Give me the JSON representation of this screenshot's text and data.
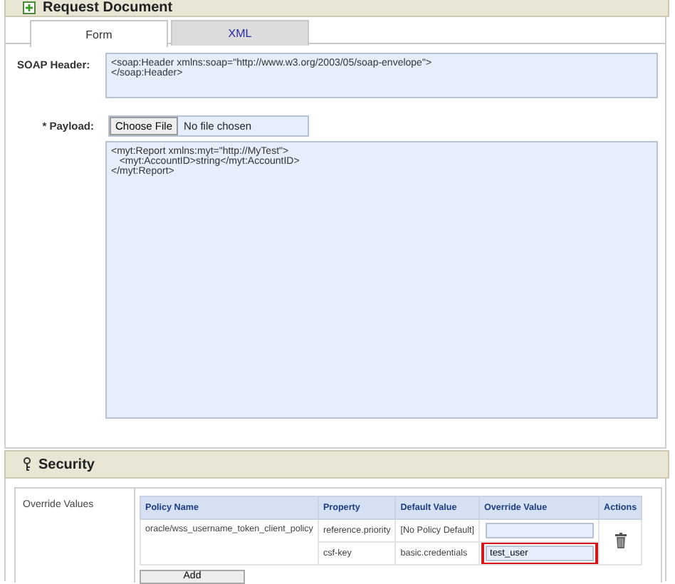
{
  "panel": {
    "title": "Request Document"
  },
  "tabs": [
    {
      "label": "Form",
      "selected": true
    },
    {
      "label": "XML",
      "selected": false
    }
  ],
  "soap_header": {
    "label": "SOAP Header:",
    "value": "<soap:Header xmlns:soap=\"http://www.w3.org/2003/05/soap-envelope\">\n</soap:Header>"
  },
  "payload": {
    "required_mark": "*",
    "label": "Payload:",
    "file_button": "Choose File",
    "file_status": "No file chosen",
    "value": "<myt:Report xmlns:myt=\"http://MyTest\">\n   <myt:AccountID>string</myt:AccountID>\n</myt:Report>"
  },
  "security": {
    "title": "Security",
    "override_label": "Override Values",
    "table": {
      "columns": [
        "Policy Name",
        "Property",
        "Default Value",
        "Override Value",
        "Actions"
      ],
      "policies": [
        {
          "name": "oracle/wss_username_token_client_policy",
          "properties": [
            {
              "property": "reference.priority",
              "default": "[No Policy Default]",
              "highlighted": false
            },
            {
              "property": "csf-key",
              "default": "basic.credentials",
              "override": "test_user",
              "highlighted": true
            }
          ]
        }
      ]
    },
    "add_button": "Add"
  }
}
